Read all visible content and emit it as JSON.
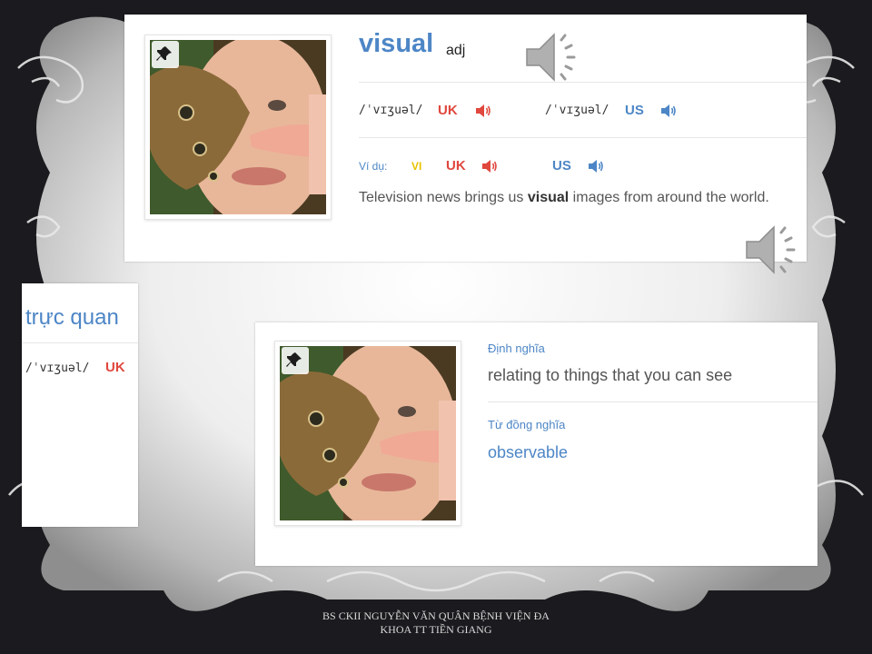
{
  "colors": {
    "accent_blue": "#4d86c6",
    "uk_red": "#e0473d",
    "vi_yellow": "#e7c200"
  },
  "top_card": {
    "headword": "visual",
    "part_of_speech": "adj",
    "pin_icon": "pushpin-icon",
    "pronunciations": [
      {
        "ipa": "/ˈvɪʒuəl/",
        "region": "UK",
        "icon": "speaker-icon"
      },
      {
        "ipa": "/ˈvɪʒuəl/",
        "region": "US",
        "icon": "speaker-icon"
      }
    ],
    "example": {
      "label": "Ví dụ:",
      "vi": "VI",
      "uk": "UK",
      "us": "US",
      "text_before": "Television news brings us ",
      "highlight": "visual",
      "text_after": " images from around the world."
    }
  },
  "left_card": {
    "translation": "trực quan",
    "ipa": "/ˈvɪʒuəl/",
    "region": "UK"
  },
  "bottom_card": {
    "definition_label": "Định nghĩa",
    "definition": "relating to things that you can see",
    "synonym_label": "Từ đồng nghĩa",
    "synonym": "observable"
  },
  "footer": {
    "line1": "BS CKII NGUYỄN VĂN QUÂN BỆNH VIỆN ĐA",
    "line2": "KHOA TT TIỀN GIANG"
  }
}
